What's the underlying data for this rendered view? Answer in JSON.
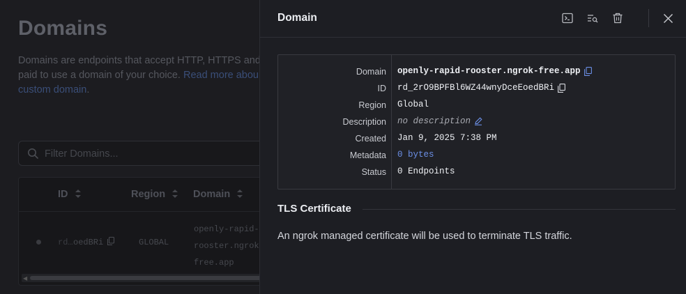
{
  "background": {
    "title": "Domains",
    "description_part1": "Domains are endpoints that accept HTTP, HTTPS and",
    "description_part2": "paid to use a domain of your choice.",
    "read_more": "Read more abou",
    "custom_domain": "custom domain",
    "period": ".",
    "search_placeholder": "Filter Domains...",
    "table": {
      "headers": [
        "ID",
        "Region",
        "Domain"
      ],
      "row": {
        "id_prefix": "rd…",
        "id_suffix": "oedBRi",
        "region": "GLOBAL",
        "domain_lines": [
          "openly-rapid-",
          "rooster.ngrok",
          "free.app"
        ]
      }
    }
  },
  "drawer": {
    "title": "Domain",
    "actions": [
      "terminal-icon",
      "search-list-icon",
      "trash-icon",
      "close-icon"
    ],
    "details": [
      {
        "label": "Domain",
        "value": "openly-rapid-rooster.ngrok-free.app"
      },
      {
        "label": "ID",
        "value": "rd_2rO9BPFBl6WZ44wnyDceEoedBRi"
      },
      {
        "label": "Region",
        "value": "Global"
      },
      {
        "label": "Description",
        "value": "no description"
      },
      {
        "label": "Created",
        "value": "Jan 9, 2025 7:38 PM"
      },
      {
        "label": "Metadata",
        "value": "0 bytes"
      },
      {
        "label": "Status",
        "value": "0 Endpoints"
      }
    ],
    "tls": {
      "title": "TLS Certificate",
      "text": "An ngrok managed certificate will be used to terminate TLS traffic."
    }
  },
  "colors": {
    "accent_link": "#6b8fe6",
    "drawer_bg": "#1d1e23",
    "overlay_bg": "#1c1c20"
  }
}
